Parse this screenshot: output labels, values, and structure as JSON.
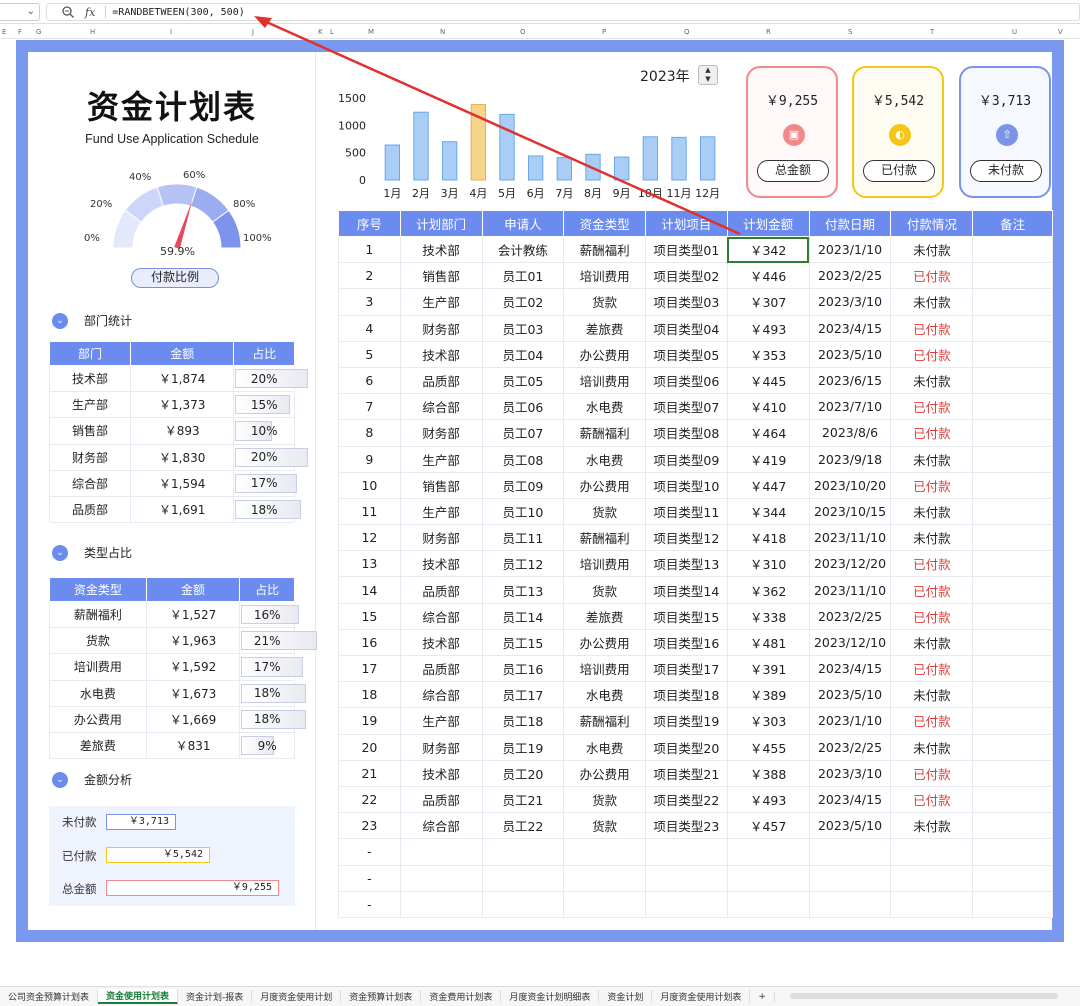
{
  "formula": {
    "text": "=RANDBETWEEN(300, 500)",
    "fx": "fx"
  },
  "columns": [
    "E",
    "F",
    "G",
    "H",
    "I",
    "J",
    "K",
    "L",
    "M",
    "N",
    "O",
    "P",
    "Q",
    "R",
    "S",
    "T",
    "U",
    "V"
  ],
  "left": {
    "title": "资金计划表",
    "subtitle": "Fund Use Application Schedule",
    "gauge": {
      "ticks": [
        "0%",
        "20%",
        "40%",
        "60%",
        "80%",
        "100%"
      ],
      "value_text": "59.9%",
      "value": 0.599
    },
    "ratio_label": "付款比例",
    "dept": {
      "heading": "部门统计",
      "headers": [
        "部门",
        "金额",
        "占比"
      ],
      "rows": [
        {
          "name": "技术部",
          "amount": "￥1,874",
          "pct": "20%",
          "frac": 0.2
        },
        {
          "name": "生产部",
          "amount": "￥1,373",
          "pct": "15%",
          "frac": 0.15
        },
        {
          "name": "销售部",
          "amount": "￥893",
          "pct": "10%",
          "frac": 0.1
        },
        {
          "name": "财务部",
          "amount": "￥1,830",
          "pct": "20%",
          "frac": 0.2
        },
        {
          "name": "综合部",
          "amount": "￥1,594",
          "pct": "17%",
          "frac": 0.17
        },
        {
          "name": "品质部",
          "amount": "￥1,691",
          "pct": "18%",
          "frac": 0.18
        }
      ]
    },
    "type": {
      "heading": "类型占比",
      "headers": [
        "资金类型",
        "金额",
        "占比"
      ],
      "rows": [
        {
          "name": "薪酬福利",
          "amount": "￥1,527",
          "pct": "16%",
          "frac": 0.16
        },
        {
          "name": "货款",
          "amount": "￥1,963",
          "pct": "21%",
          "frac": 0.21
        },
        {
          "name": "培训费用",
          "amount": "￥1,592",
          "pct": "17%",
          "frac": 0.17
        },
        {
          "name": "水电费",
          "amount": "￥1,673",
          "pct": "18%",
          "frac": 0.18
        },
        {
          "name": "办公费用",
          "amount": "￥1,669",
          "pct": "18%",
          "frac": 0.18
        },
        {
          "name": "差旅费",
          "amount": "￥831",
          "pct": "9%",
          "frac": 0.09
        }
      ]
    },
    "analysis": {
      "heading": "金额分析",
      "unpaid_label": "未付款",
      "unpaid": "￥3,713",
      "paid_label": "已付款",
      "paid": "￥5,542",
      "total_label": "总金额",
      "total": "￥9,255"
    }
  },
  "year": "2023年",
  "cards": [
    {
      "amount": "￥9,255",
      "label": "总金额",
      "color": "#f08a8a",
      "icon": "wallet-icon"
    },
    {
      "amount": "￥5,542",
      "label": "已付款",
      "color": "#f5c518",
      "icon": "coin-icon"
    },
    {
      "amount": "￥3,713",
      "label": "未付款",
      "color": "#7b93e8",
      "icon": "upload-icon"
    }
  ],
  "chart_data": {
    "type": "bar",
    "categories": [
      "1月",
      "2月",
      "3月",
      "4月",
      "5月",
      "6月",
      "7月",
      "8月",
      "9月",
      "10月",
      "11月",
      "12月"
    ],
    "values": [
      640,
      1240,
      700,
      1380,
      1200,
      440,
      410,
      470,
      420,
      790,
      780,
      790
    ],
    "highlight_index": 3,
    "yticks": [
      "0",
      "500",
      "1000",
      "1500"
    ],
    "ylim": [
      0,
      1500
    ],
    "color": "#a9cdf5",
    "highlight_color": "#f5d58a"
  },
  "main": {
    "headers": [
      "序号",
      "计划部门",
      "申请人",
      "资金类型",
      "计划项目",
      "计划金额",
      "付款日期",
      "付款情况",
      "备注"
    ],
    "rows": [
      [
        "1",
        "技术部",
        "会计教练",
        "薪酬福利",
        "项目类型01",
        "￥342",
        "2023/1/10",
        "未付款"
      ],
      [
        "2",
        "销售部",
        "员工01",
        "培训费用",
        "项目类型02",
        "￥446",
        "2023/2/25",
        "已付款"
      ],
      [
        "3",
        "生产部",
        "员工02",
        "货款",
        "项目类型03",
        "￥307",
        "2023/3/10",
        "未付款"
      ],
      [
        "4",
        "财务部",
        "员工03",
        "差旅费",
        "项目类型04",
        "￥493",
        "2023/4/15",
        "已付款"
      ],
      [
        "5",
        "技术部",
        "员工04",
        "办公费用",
        "项目类型05",
        "￥353",
        "2023/5/10",
        "已付款"
      ],
      [
        "6",
        "品质部",
        "员工05",
        "培训费用",
        "项目类型06",
        "￥445",
        "2023/6/15",
        "未付款"
      ],
      [
        "7",
        "综合部",
        "员工06",
        "水电费",
        "项目类型07",
        "￥410",
        "2023/7/10",
        "已付款"
      ],
      [
        "8",
        "财务部",
        "员工07",
        "薪酬福利",
        "项目类型08",
        "￥464",
        "2023/8/6",
        "已付款"
      ],
      [
        "9",
        "生产部",
        "员工08",
        "水电费",
        "项目类型09",
        "￥419",
        "2023/9/18",
        "未付款"
      ],
      [
        "10",
        "销售部",
        "员工09",
        "办公费用",
        "项目类型10",
        "￥447",
        "2023/10/20",
        "已付款"
      ],
      [
        "11",
        "生产部",
        "员工10",
        "货款",
        "项目类型11",
        "￥344",
        "2023/10/15",
        "未付款"
      ],
      [
        "12",
        "财务部",
        "员工11",
        "薪酬福利",
        "项目类型12",
        "￥418",
        "2023/11/10",
        "未付款"
      ],
      [
        "13",
        "技术部",
        "员工12",
        "培训费用",
        "项目类型13",
        "￥310",
        "2023/12/20",
        "已付款"
      ],
      [
        "14",
        "品质部",
        "员工13",
        "货款",
        "项目类型14",
        "￥362",
        "2023/11/10",
        "已付款"
      ],
      [
        "15",
        "综合部",
        "员工14",
        "差旅费",
        "项目类型15",
        "￥338",
        "2023/2/25",
        "已付款"
      ],
      [
        "16",
        "技术部",
        "员工15",
        "办公费用",
        "项目类型16",
        "￥481",
        "2023/12/10",
        "未付款"
      ],
      [
        "17",
        "品质部",
        "员工16",
        "培训费用",
        "项目类型17",
        "￥391",
        "2023/4/15",
        "已付款"
      ],
      [
        "18",
        "综合部",
        "员工17",
        "水电费",
        "项目类型18",
        "￥389",
        "2023/5/10",
        "未付款"
      ],
      [
        "19",
        "生产部",
        "员工18",
        "薪酬福利",
        "项目类型19",
        "￥303",
        "2023/1/10",
        "已付款"
      ],
      [
        "20",
        "财务部",
        "员工19",
        "水电费",
        "项目类型20",
        "￥455",
        "2023/2/25",
        "未付款"
      ],
      [
        "21",
        "技术部",
        "员工20",
        "办公费用",
        "项目类型21",
        "￥388",
        "2023/3/10",
        "已付款"
      ],
      [
        "22",
        "品质部",
        "员工21",
        "货款",
        "项目类型22",
        "￥493",
        "2023/4/15",
        "已付款"
      ],
      [
        "23",
        "综合部",
        "员工22",
        "货款",
        "项目类型23",
        "￥457",
        "2023/5/10",
        "未付款"
      ],
      [
        "-",
        "",
        "",
        "",
        "",
        "",
        "",
        "",
        ""
      ],
      [
        "-",
        "",
        "",
        "",
        "",
        "",
        "",
        "",
        ""
      ],
      [
        "-",
        "",
        "",
        "",
        "",
        "",
        "",
        "",
        ""
      ]
    ],
    "paid_text": "已付款"
  },
  "tabs": [
    "公司资金预算计划表",
    "资金使用计划表",
    "资金计划-报表",
    "月度资金使用计划",
    "资金预算计划表",
    "资金费用计划表",
    "月度资金计划明细表",
    "资金计划",
    "月度资金使用计划表",
    "+"
  ],
  "active_tab": 1
}
